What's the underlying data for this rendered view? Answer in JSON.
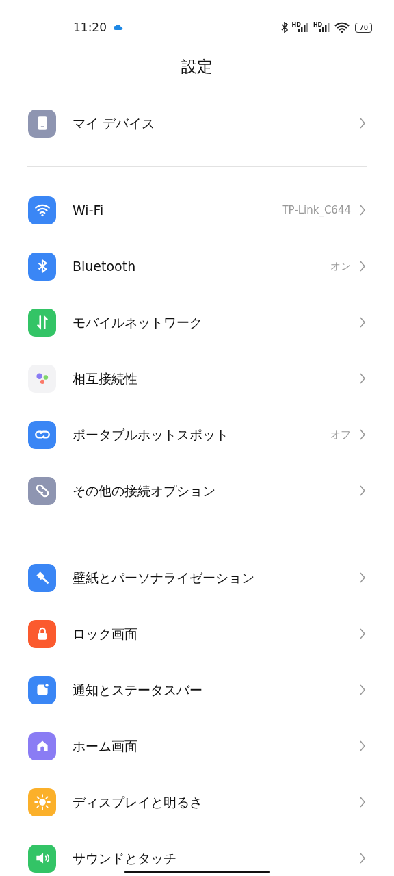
{
  "status_bar": {
    "time": "11:20",
    "signal_labels": [
      "HD",
      "HD"
    ],
    "battery": "70"
  },
  "title": "設定",
  "groups": [
    {
      "items": [
        {
          "kind": "device",
          "label": "マイ デバイス"
        }
      ]
    },
    {
      "items": [
        {
          "kind": "wifi",
          "label": "Wi-Fi",
          "value": "TP-Link_C644"
        },
        {
          "kind": "bluetooth",
          "label": "Bluetooth",
          "value": "オン"
        },
        {
          "kind": "mobile",
          "label": "モバイルネットワーク"
        },
        {
          "kind": "interconnect",
          "label": "相互接続性"
        },
        {
          "kind": "hotspot",
          "label": "ポータブルホットスポット",
          "value": "オフ"
        },
        {
          "kind": "link",
          "label": "その他の接続オプション"
        }
      ]
    },
    {
      "items": [
        {
          "kind": "wallpaper",
          "label": "壁紙とパーソナライゼーション"
        },
        {
          "kind": "lock",
          "label": "ロック画面"
        },
        {
          "kind": "notification",
          "label": "通知とステータスバー"
        },
        {
          "kind": "home",
          "label": "ホーム画面"
        },
        {
          "kind": "display",
          "label": "ディスプレイと明るさ"
        },
        {
          "kind": "sound",
          "label": "サウンドとタッチ"
        }
      ]
    }
  ]
}
